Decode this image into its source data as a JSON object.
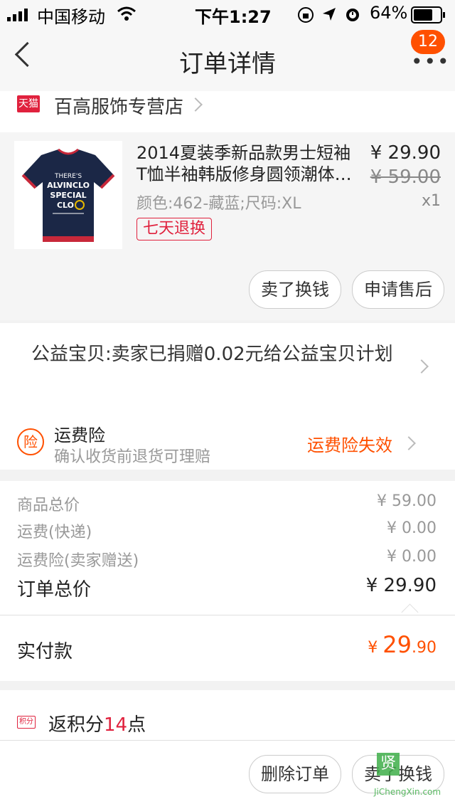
{
  "status_bar": {
    "carrier": "中国移动",
    "time": "下午1:27",
    "battery": "64%"
  },
  "nav": {
    "title": "订单详情",
    "badge": "12",
    "more": "•••"
  },
  "shop": {
    "badge": "天猫",
    "name": "百高服饰专营店"
  },
  "product": {
    "title": "2014夏装季新品款男士短袖T恤半袖韩版修身圆领潮体…",
    "price": "¥ 29.90",
    "original_price": "¥ 59.00",
    "quantity": "x1",
    "sku": "颜色:462-藏蓝;尺码:XL",
    "tag": "七天退换",
    "shirt_text": "THERE'S ALVINCLO SPECIAL CLO",
    "buttons": {
      "sell": "卖了换钱",
      "after_sale": "申请售后"
    }
  },
  "charity": {
    "text": "公益宝贝:卖家已捐赠0.02元给公益宝贝计划"
  },
  "insurance": {
    "icon": "险",
    "title": "运费险",
    "subtitle": "确认收货前退货可理赔",
    "status": "运费险失效"
  },
  "totals": {
    "rows": [
      {
        "label": "商品总价",
        "value": "¥ 59.00"
      },
      {
        "label": "运费(快递)",
        "value": "¥ 0.00"
      },
      {
        "label": "运费险(卖家赠送)",
        "value": "¥ 0.00"
      }
    ],
    "order_total_label": "订单总价",
    "order_total_value": "¥ 29.90"
  },
  "paid": {
    "label": "实付款",
    "currency": "¥ ",
    "integer": "29",
    "decimal": ".90"
  },
  "points": {
    "badge": "积分",
    "prefix": "返积分",
    "count": "14",
    "suffix": "点"
  },
  "bottom": {
    "delete": "删除订单",
    "sell": "卖了换钱"
  },
  "watermark": {
    "logo": "贤",
    "text": "JiChengXin.com"
  },
  "colors": {
    "accent": "#ff5000",
    "tmall_red": "#e0213d"
  }
}
